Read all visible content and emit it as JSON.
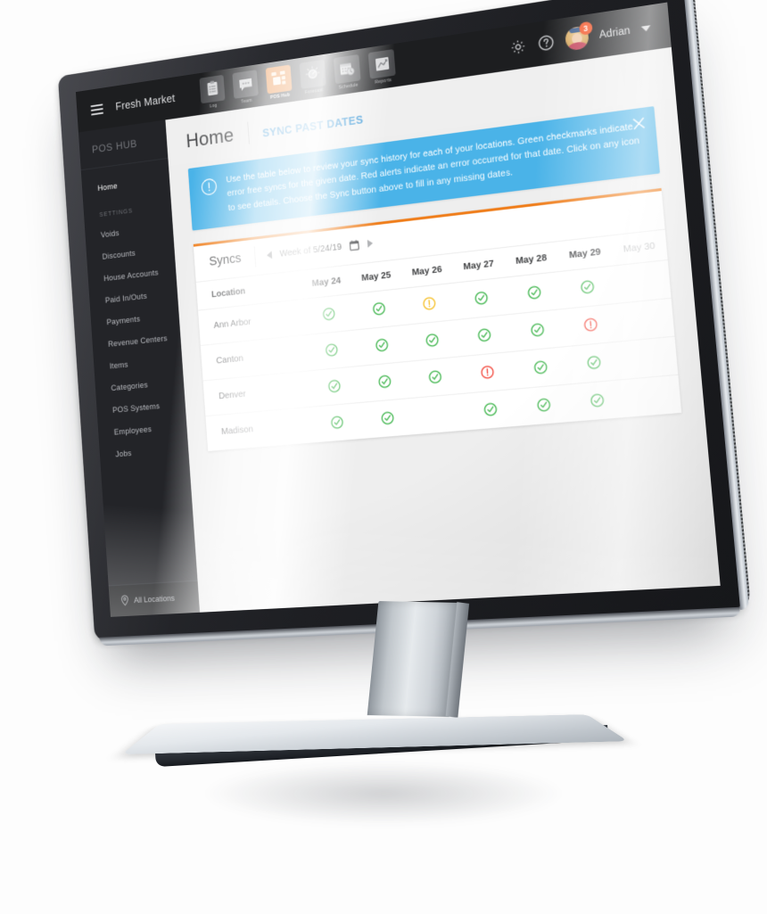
{
  "topbar": {
    "brand": "Fresh Market",
    "menu_icon": "hamburger-icon",
    "nav": [
      {
        "label": "Log",
        "icon": "clipboard-icon",
        "active": false
      },
      {
        "label": "Team",
        "icon": "chat-bubble-icon",
        "active": false
      },
      {
        "label": "POS Hub",
        "icon": "pos-grid-icon",
        "active": true
      },
      {
        "label": "Forecast",
        "icon": "gauge-icon",
        "active": false
      },
      {
        "label": "Schedule",
        "icon": "calendar-clock-icon",
        "active": false
      },
      {
        "label": "Reports",
        "icon": "line-chart-icon",
        "active": false
      }
    ],
    "settings_icon": "gear-icon",
    "help_icon": "question-circle-icon",
    "notification_count": "3",
    "username": "Adrian",
    "user_chevron": "chevron-down-icon"
  },
  "sidebar": {
    "title": "POS HUB",
    "items": [
      {
        "label": "Home",
        "active": true
      }
    ],
    "section_label": "SETTINGS",
    "settings_items": [
      {
        "label": "Voids"
      },
      {
        "label": "Discounts"
      },
      {
        "label": "House Accounts"
      },
      {
        "label": "Paid In/Outs"
      },
      {
        "label": "Payments"
      },
      {
        "label": "Revenue Centers"
      },
      {
        "label": "Items"
      },
      {
        "label": "Categories"
      },
      {
        "label": "POS Systems"
      },
      {
        "label": "Employees"
      },
      {
        "label": "Jobs"
      }
    ],
    "footer": {
      "label": "All Locations",
      "icon": "location-pin-icon"
    }
  },
  "page": {
    "title": "Home",
    "action_link": "SYNC PAST DATES"
  },
  "banner": {
    "icon": "exclamation-circle-icon",
    "close_icon": "close-icon",
    "text": "Use the table below to review your sync history for each of your locations. Green checkmarks indicate error free syncs for the given date. Red alerts indicate an error occurred for that date. Click on any icon to see details. Choose the Sync button above to fill in any missing dates.",
    "background_color": "#4ab3e8"
  },
  "card": {
    "accent_color": "#ef7d1a",
    "title": "Syncs",
    "prev_icon": "triangle-left-icon",
    "next_icon": "triangle-right-icon",
    "week_label": "Week of 5/24/19",
    "calendar_icon": "calendar-icon"
  },
  "table": {
    "columns": [
      {
        "label": "Location",
        "future": false
      },
      {
        "label": "May 24",
        "future": false
      },
      {
        "label": "May 25",
        "future": false
      },
      {
        "label": "May 26",
        "future": false
      },
      {
        "label": "May 27",
        "future": false
      },
      {
        "label": "May 28",
        "future": false
      },
      {
        "label": "May 29",
        "future": false
      },
      {
        "label": "May 30",
        "future": true
      }
    ],
    "rows": [
      {
        "location": "Ann Arbor",
        "statuses": [
          "ok",
          "ok",
          "warn",
          "ok",
          "ok",
          "ok",
          "none"
        ]
      },
      {
        "location": "Canton",
        "statuses": [
          "ok",
          "ok",
          "ok",
          "ok",
          "ok",
          "error",
          "none"
        ]
      },
      {
        "location": "Denver",
        "statuses": [
          "ok",
          "ok",
          "ok",
          "error",
          "ok",
          "ok",
          "none"
        ]
      },
      {
        "location": "Madison",
        "statuses": [
          "ok",
          "ok",
          "none",
          "ok",
          "ok",
          "ok",
          "none"
        ]
      }
    ],
    "status_colors": {
      "ok": "#3cb44a",
      "warn": "#f5bd20",
      "error": "#f24438",
      "none": ""
    }
  }
}
